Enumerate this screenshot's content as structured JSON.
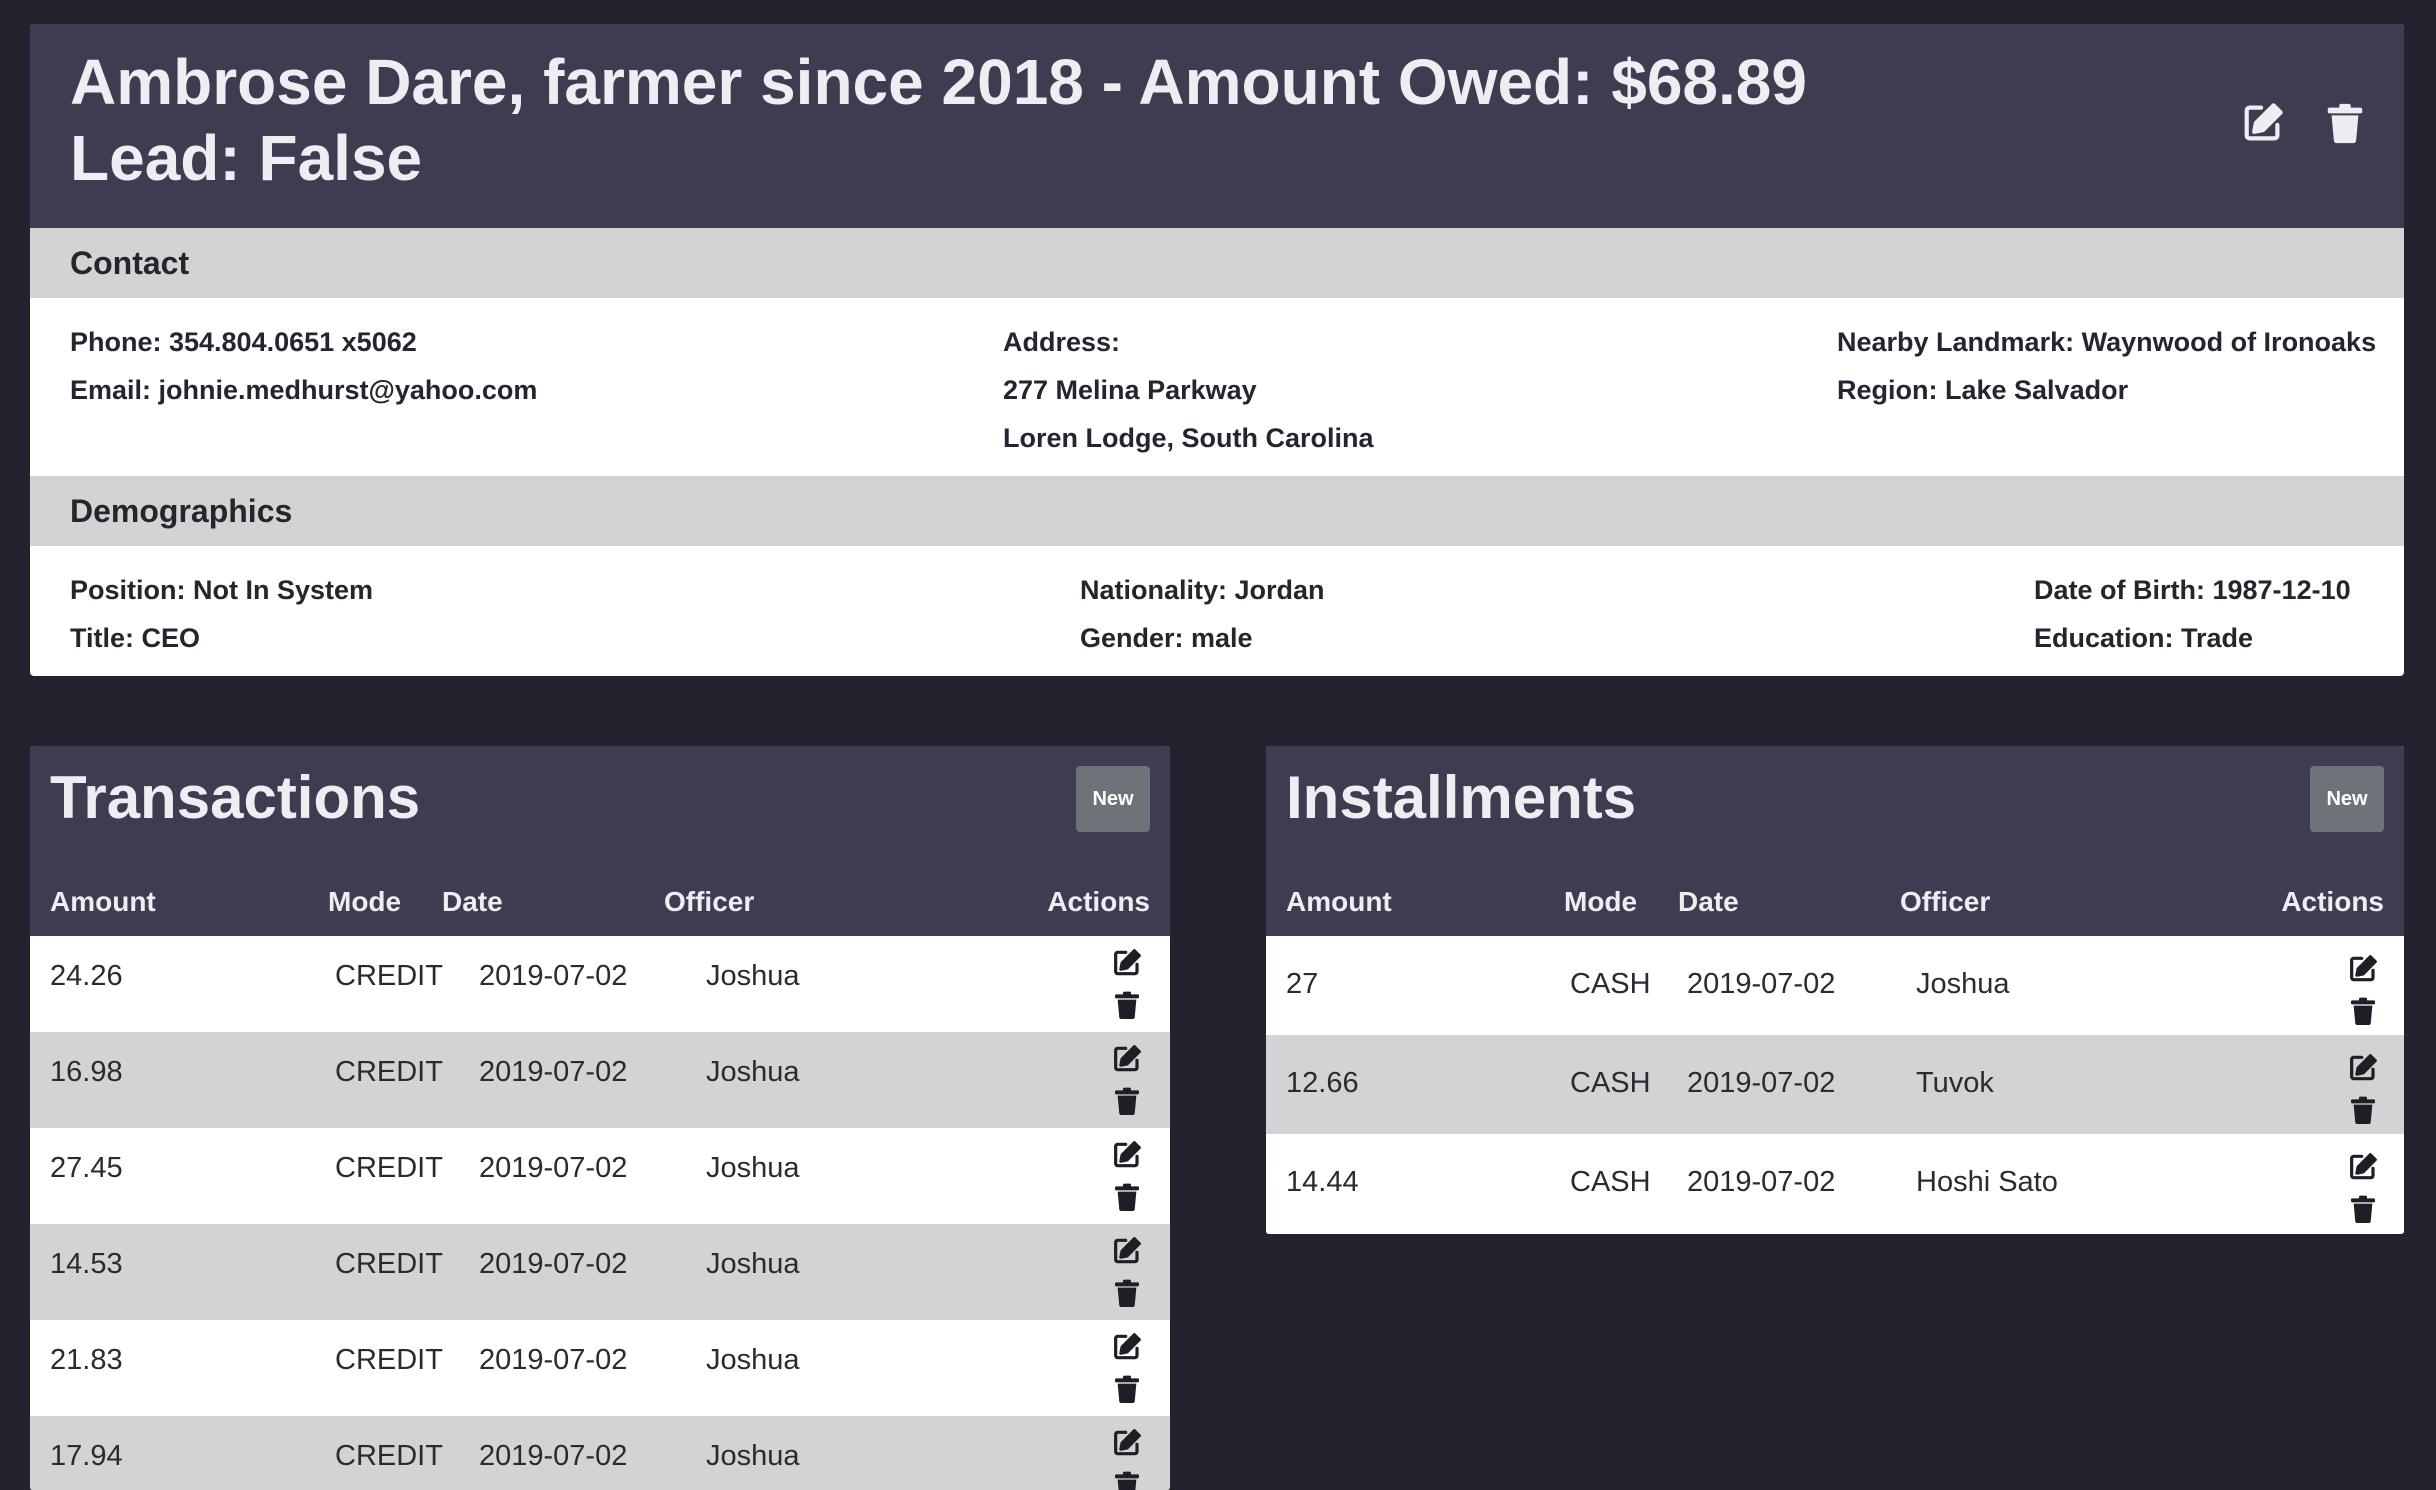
{
  "farmer": {
    "title_line1": "Ambrose Dare, farmer since 2018 - Amount Owed: $68.89",
    "title_line2": "Lead: False",
    "edit_icon": "edit-icon",
    "delete_icon": "trash-icon"
  },
  "contact": {
    "heading": "Contact",
    "phone": "Phone: 354.804.0651 x5062",
    "email": "Email: johnie.medhurst@yahoo.com",
    "address_label": "Address:",
    "address_line1": "277 Melina Parkway",
    "address_line2": "Loren Lodge, South Carolina",
    "landmark": "Nearby Landmark: Waynwood of Ironoaks",
    "region": "Region: Lake Salvador"
  },
  "demographics": {
    "heading": "Demographics",
    "position": "Position: Not In System",
    "title": "Title: CEO",
    "nationality": "Nationality: Jordan",
    "gender": "Gender: male",
    "dob": "Date of Birth: 1987-12-10",
    "education": "Education: Trade"
  },
  "transactions": {
    "heading": "Transactions",
    "new_label": "New",
    "columns": [
      "Amount",
      "Mode",
      "Date",
      "Officer",
      "Actions"
    ],
    "rows": [
      {
        "amount": "24.26",
        "mode": "CREDIT",
        "date": "2019-07-02",
        "officer": "Joshua"
      },
      {
        "amount": "16.98",
        "mode": "CREDIT",
        "date": "2019-07-02",
        "officer": "Joshua"
      },
      {
        "amount": "27.45",
        "mode": "CREDIT",
        "date": "2019-07-02",
        "officer": "Joshua"
      },
      {
        "amount": "14.53",
        "mode": "CREDIT",
        "date": "2019-07-02",
        "officer": "Joshua"
      },
      {
        "amount": "21.83",
        "mode": "CREDIT",
        "date": "2019-07-02",
        "officer": "Joshua"
      },
      {
        "amount": "17.94",
        "mode": "CREDIT",
        "date": "2019-07-02",
        "officer": "Joshua"
      }
    ]
  },
  "installments": {
    "heading": "Installments",
    "new_label": "New",
    "columns": [
      "Amount",
      "Mode",
      "Date",
      "Officer",
      "Actions"
    ],
    "rows": [
      {
        "amount": "27",
        "mode": "CASH",
        "date": "2019-07-02",
        "officer": "Joshua"
      },
      {
        "amount": "12.66",
        "mode": "CASH",
        "date": "2019-07-02",
        "officer": "Tuvok"
      },
      {
        "amount": "14.44",
        "mode": "CASH",
        "date": "2019-07-02",
        "officer": "Hoshi Sato"
      }
    ]
  },
  "colors": {
    "page_bg": "#23222f",
    "header_bg": "#3e3c50",
    "section_bar": "#d3d3d3",
    "new_button": "#6e737a"
  }
}
